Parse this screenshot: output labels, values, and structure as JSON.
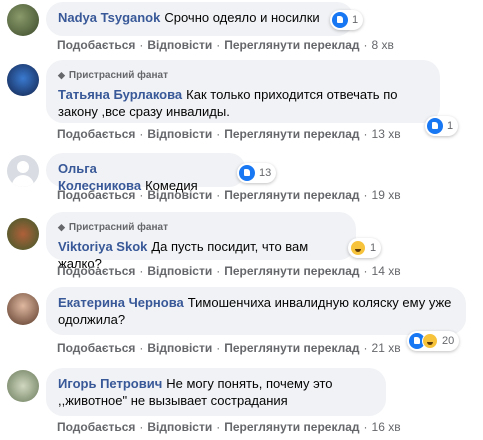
{
  "comments": [
    {
      "badge": "",
      "author": "Nadya Tsyganok",
      "text": "Срочно одеяло и носилки",
      "reaction_count": "1",
      "actions": [
        "Подобається",
        "Відповісти",
        "Переглянути переклад"
      ],
      "time": "8 хв"
    },
    {
      "badge": "Пристрасний фанат",
      "author": "Татьяна Бурлакова",
      "text": "Как только приходится отвечать по закону ,все сразу инвалиды.",
      "reaction_count": "1",
      "actions": [
        "Подобається",
        "Відповісти",
        "Переглянути переклад"
      ],
      "time": "13 хв"
    },
    {
      "badge": "",
      "author": "Ольга Колесникова",
      "text": "Комедия",
      "reaction_count": "13",
      "actions": [
        "Подобається",
        "Відповісти",
        "Переглянути переклад"
      ],
      "time": "19 хв"
    },
    {
      "badge": "Пристрасний фанат",
      "author": "Viktoriya Skok",
      "text": "Да пусть посидит, что вам жалко?",
      "reaction_count": "1",
      "actions": [
        "Подобається",
        "Відповісти",
        "Переглянути переклад"
      ],
      "time": "14 хв"
    },
    {
      "badge": "",
      "author": "Екатерина Чернова",
      "text": "Тимошенчиха инвалидную коляску ему уже одолжила?",
      "reaction_count": "20",
      "actions": [
        "Подобається",
        "Відповісти",
        "Переглянути переклад"
      ],
      "time": "21 хв"
    },
    {
      "badge": "",
      "author": "Игорь Петрович",
      "text": "Не могу понять, почему это ,,животное\" не вызывает сострадания",
      "reaction_count": "",
      "actions": [
        "Подобається",
        "Відповісти",
        "Переглянути переклад"
      ],
      "time": "16 хв"
    }
  ],
  "colors": {
    "bubble": "#f0f2f5",
    "like": "#1877f2",
    "secondary_text": "#65676b"
  }
}
